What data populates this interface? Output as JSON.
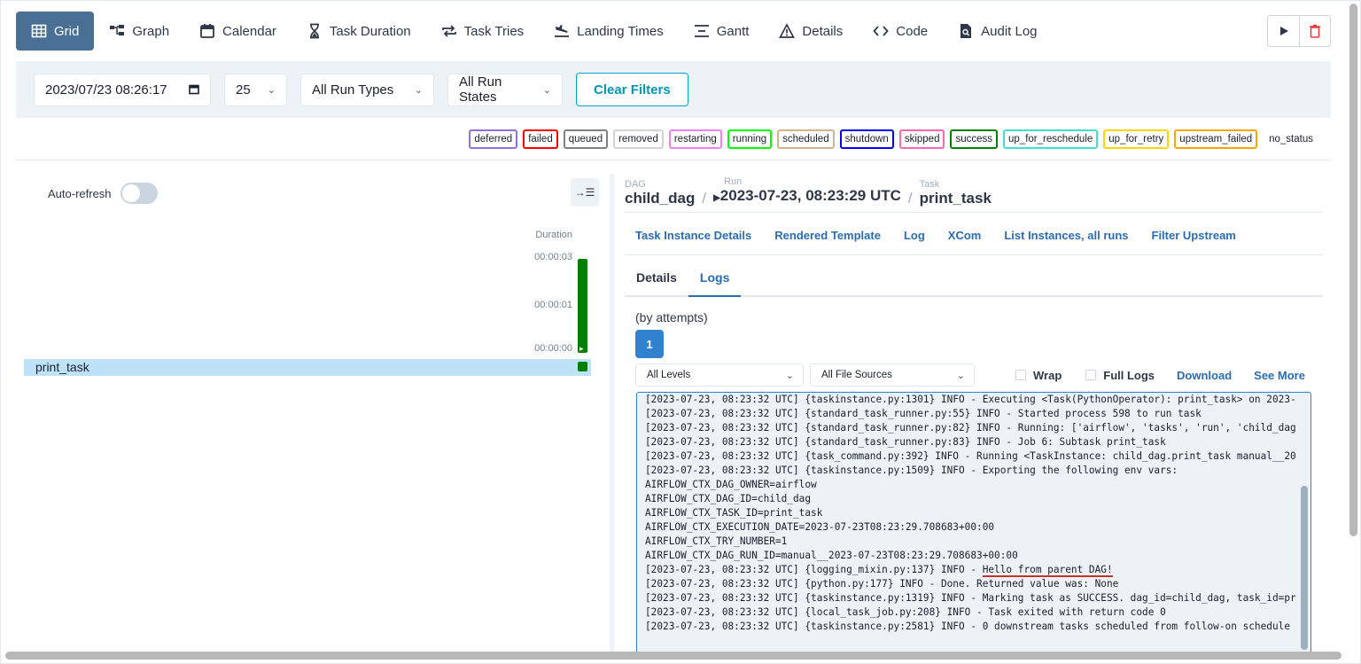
{
  "nav": {
    "items": [
      {
        "label": "Grid",
        "icon": "grid-icon",
        "active": true
      },
      {
        "label": "Graph",
        "icon": "graph-icon"
      },
      {
        "label": "Calendar",
        "icon": "calendar-icon"
      },
      {
        "label": "Task Duration",
        "icon": "hourglass-icon"
      },
      {
        "label": "Task Tries",
        "icon": "repeat-icon"
      },
      {
        "label": "Landing Times",
        "icon": "plane-landing-icon"
      },
      {
        "label": "Gantt",
        "icon": "gantt-icon"
      },
      {
        "label": "Details",
        "icon": "warning-triangle-icon"
      },
      {
        "label": "Code",
        "icon": "code-icon"
      },
      {
        "label": "Audit Log",
        "icon": "audit-doc-icon"
      }
    ],
    "actions": [
      {
        "icon": "play-icon",
        "color": "#2d3748"
      },
      {
        "icon": "trash-icon",
        "color": "#e53e3e"
      }
    ]
  },
  "filters": {
    "base_date": "2023/07/23 08:26:17",
    "num_runs": "25",
    "run_type": "All Run Types",
    "run_state": "All Run States",
    "clear_label": "Clear Filters"
  },
  "legend": [
    {
      "label": "deferred",
      "color": "#9370db"
    },
    {
      "label": "failed",
      "color": "#ff0000"
    },
    {
      "label": "queued",
      "color": "#808080"
    },
    {
      "label": "removed",
      "color": "#d3d3d3"
    },
    {
      "label": "restarting",
      "color": "#ee82ee"
    },
    {
      "label": "running",
      "color": "#00ff00"
    },
    {
      "label": "scheduled",
      "color": "#d2b48c"
    },
    {
      "label": "shutdown",
      "color": "#0000ff"
    },
    {
      "label": "skipped",
      "color": "#ff69b4"
    },
    {
      "label": "success",
      "color": "#008000"
    },
    {
      "label": "up_for_reschedule",
      "color": "#40e0d0"
    },
    {
      "label": "up_for_retry",
      "color": "#ffd700"
    },
    {
      "label": "upstream_failed",
      "color": "#ffa500"
    },
    {
      "label": "no_status",
      "color": "none"
    }
  ],
  "grid": {
    "auto_refresh_label": "Auto-refresh",
    "duration_header": "Duration",
    "duration_ticks": [
      "00:00:03",
      "00:00:01",
      "00:00:00"
    ],
    "task_name": "print_task"
  },
  "breadcrumb": {
    "dag_label": "DAG",
    "dag_value": "child_dag",
    "run_label": "Run",
    "run_value": "2023-07-23, 08:23:29 UTC",
    "task_label": "Task",
    "task_value": "print_task"
  },
  "subnav": [
    "Task Instance Details",
    "Rendered Template",
    "Log",
    "XCom",
    "List Instances, all runs",
    "Filter Upstream"
  ],
  "tabs": [
    {
      "label": "Details",
      "active": false
    },
    {
      "label": "Logs",
      "active": true
    }
  ],
  "logs": {
    "attempts_label": "(by attempts)",
    "attempt_number": "1",
    "levels_select": "All Levels",
    "sources_select": "All File Sources",
    "wrap_label": "Wrap",
    "full_logs_label": "Full Logs",
    "download_label": "Download",
    "see_more_label": "See More",
    "lines": [
      "[2023-07-23, 08:23:32 UTC] {taskinstance.py:1301} INFO - Executing <Task(PythonOperator): print_task> on 2023-",
      "[2023-07-23, 08:23:32 UTC] {standard_task_runner.py:55} INFO - Started process 598 to run task",
      "[2023-07-23, 08:23:32 UTC] {standard_task_runner.py:82} INFO - Running: ['airflow', 'tasks', 'run', 'child_dag",
      "[2023-07-23, 08:23:32 UTC] {standard_task_runner.py:83} INFO - Job 6: Subtask print_task",
      "[2023-07-23, 08:23:32 UTC] {task_command.py:392} INFO - Running <TaskInstance: child_dag.print_task manual__20",
      "[2023-07-23, 08:23:32 UTC] {taskinstance.py:1509} INFO - Exporting the following env vars:",
      "AIRFLOW_CTX_DAG_OWNER=airflow",
      "AIRFLOW_CTX_DAG_ID=child_dag",
      "AIRFLOW_CTX_TASK_ID=print_task",
      "AIRFLOW_CTX_EXECUTION_DATE=2023-07-23T08:23:29.708683+00:00",
      "AIRFLOW_CTX_TRY_NUMBER=1",
      "AIRFLOW_CTX_DAG_RUN_ID=manual__2023-07-23T08:23:29.708683+00:00",
      "[2023-07-23, 08:23:32 UTC] {logging_mixin.py:137} INFO - ",
      "[2023-07-23, 08:23:32 UTC] {python.py:177} INFO - Done. Returned value was: None",
      "[2023-07-23, 08:23:32 UTC] {taskinstance.py:1319} INFO - Marking task as SUCCESS. dag_id=child_dag, task_id=pr",
      "[2023-07-23, 08:23:32 UTC] {local_task_job.py:208} INFO - Task exited with return code 0",
      "[2023-07-23, 08:23:32 UTC] {taskinstance.py:2581} INFO - 0 downstream tasks scheduled from follow-on schedule"
    ],
    "highlight_text": "Hello from parent DAG!"
  }
}
